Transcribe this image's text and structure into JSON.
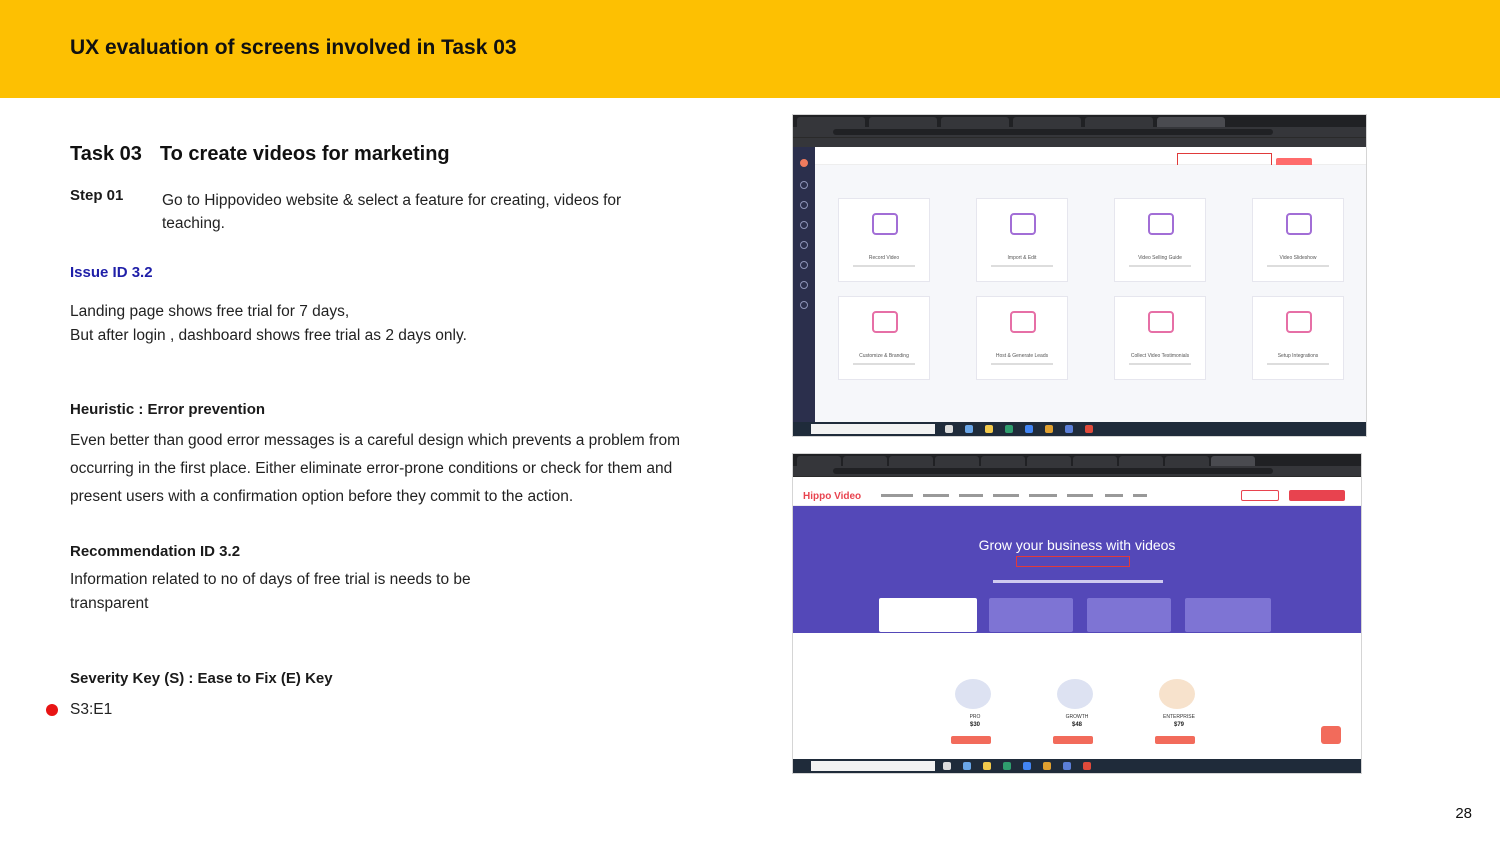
{
  "header": {
    "title": "UX evaluation of screens involved in Task 03"
  },
  "task": {
    "label": "Task 03",
    "title": "To create videos for marketing"
  },
  "step": {
    "label": "Step 01",
    "text": "Go to Hippovideo website & select a feature for creating, videos for teaching."
  },
  "issue": {
    "id": "Issue ID 3.2",
    "line1": "Landing page shows free trial for 7 days,",
    "line2": "But after login , dashboard shows free trial as 2 days only."
  },
  "heuristic": {
    "title": "Heuristic : Error prevention",
    "text": "Even better than good error messages is a careful design which prevents a problem from occurring in the first place. Either eliminate error-prone conditions or check for them and present users with a confirmation option before they commit to the action."
  },
  "recommendation": {
    "title": "Recommendation ID 3.2",
    "text": "Information related to no of days of free trial is needs to be transparent"
  },
  "severity": {
    "title": "Severity Key (S) : Ease to Fix (E) Key",
    "value": "S3:E1",
    "dot_color": "#E81414"
  },
  "page_number": "28",
  "screenshot_dashboard": {
    "cards": [
      "Record Video",
      "Import & Edit",
      "Video Selling Guide",
      "Video Slideshow",
      "Customize & Branding",
      "Host & Generate Leads",
      "Collect Video Testimonials",
      "Setup Integrations"
    ]
  },
  "screenshot_pricing": {
    "logo": "Hippo Video",
    "hero_title": "Grow your business with videos",
    "plans": [
      {
        "name": "PRO",
        "price": "$30"
      },
      {
        "name": "GROWTH",
        "price": "$48"
      },
      {
        "name": "ENTERPRISE",
        "price": "$79"
      }
    ]
  },
  "colors": {
    "header_band": "#FDC002",
    "issue_id": "#1F1FA8",
    "highlight_box": "#e03a3a"
  }
}
